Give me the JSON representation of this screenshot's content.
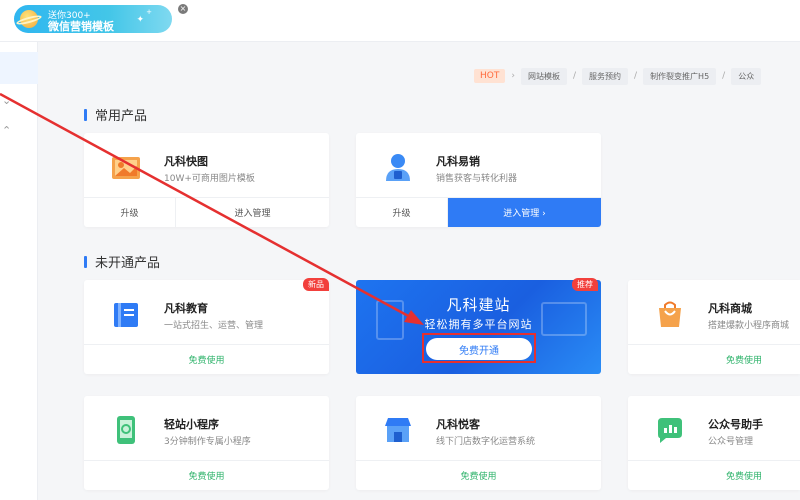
{
  "promo": {
    "line1": "送你300+",
    "line2": "微信营销模板",
    "close": "×"
  },
  "breadcrumb": {
    "hot": "HOT",
    "items": [
      "网站模板",
      "服务预约",
      "制作裂变推广H5",
      "公众"
    ]
  },
  "sections": {
    "common": "常用产品",
    "unopened": "未开通产品"
  },
  "common_products": [
    {
      "name": "凡科快图",
      "desc": "10W+可商用图片模板",
      "left_btn": "升级",
      "right_btn": "进入管理"
    },
    {
      "name": "凡科易销",
      "desc": "销售获客与转化利器",
      "left_btn": "升级",
      "right_btn": "进入管理 ›"
    }
  ],
  "unopened_products": [
    {
      "name": "凡科教育",
      "desc": "一站式招生、运营、管理",
      "action": "免费使用",
      "tag": "新品"
    },
    {
      "name": "凡科商城",
      "desc": "搭建爆款小程序商城",
      "action": "免费使用"
    },
    {
      "name": "轻站小程序",
      "desc": "3分钟制作专属小程序",
      "action": "免费使用"
    },
    {
      "name": "凡科悦客",
      "desc": "线下门店数字化运营系统",
      "action": "免费使用"
    },
    {
      "name": "公众号助手",
      "desc": "公众号管理",
      "action": "免费使用"
    }
  ],
  "banner": {
    "tag": "推荐",
    "title": "凡科建站",
    "subtitle": "轻松拥有多平台网站",
    "button": "免费开通"
  },
  "colors": {
    "primary": "#2f7bf5",
    "free": "#2fb36b",
    "tag": "#f2403c",
    "annotation": "#e53030"
  }
}
